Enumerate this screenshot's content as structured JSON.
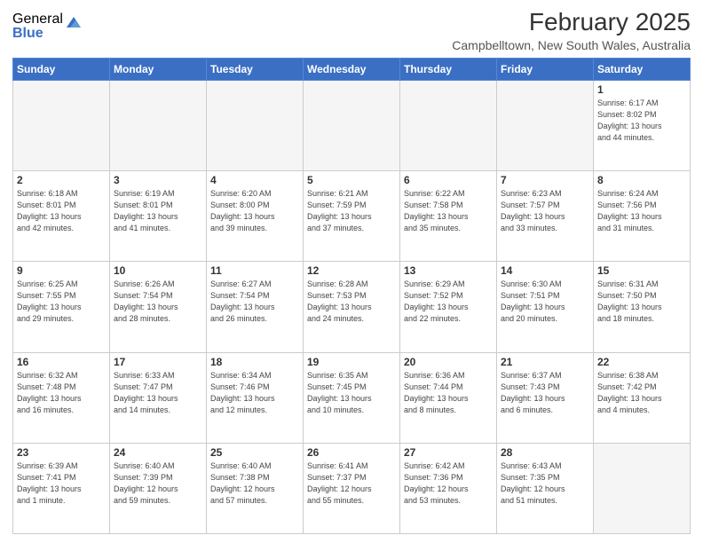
{
  "logo": {
    "general": "General",
    "blue": "Blue"
  },
  "title": "February 2025",
  "location": "Campbelltown, New South Wales, Australia",
  "days_of_week": [
    "Sunday",
    "Monday",
    "Tuesday",
    "Wednesday",
    "Thursday",
    "Friday",
    "Saturday"
  ],
  "weeks": [
    [
      {
        "day": "",
        "info": ""
      },
      {
        "day": "",
        "info": ""
      },
      {
        "day": "",
        "info": ""
      },
      {
        "day": "",
        "info": ""
      },
      {
        "day": "",
        "info": ""
      },
      {
        "day": "",
        "info": ""
      },
      {
        "day": "1",
        "info": "Sunrise: 6:17 AM\nSunset: 8:02 PM\nDaylight: 13 hours\nand 44 minutes."
      }
    ],
    [
      {
        "day": "2",
        "info": "Sunrise: 6:18 AM\nSunset: 8:01 PM\nDaylight: 13 hours\nand 42 minutes."
      },
      {
        "day": "3",
        "info": "Sunrise: 6:19 AM\nSunset: 8:01 PM\nDaylight: 13 hours\nand 41 minutes."
      },
      {
        "day": "4",
        "info": "Sunrise: 6:20 AM\nSunset: 8:00 PM\nDaylight: 13 hours\nand 39 minutes."
      },
      {
        "day": "5",
        "info": "Sunrise: 6:21 AM\nSunset: 7:59 PM\nDaylight: 13 hours\nand 37 minutes."
      },
      {
        "day": "6",
        "info": "Sunrise: 6:22 AM\nSunset: 7:58 PM\nDaylight: 13 hours\nand 35 minutes."
      },
      {
        "day": "7",
        "info": "Sunrise: 6:23 AM\nSunset: 7:57 PM\nDaylight: 13 hours\nand 33 minutes."
      },
      {
        "day": "8",
        "info": "Sunrise: 6:24 AM\nSunset: 7:56 PM\nDaylight: 13 hours\nand 31 minutes."
      }
    ],
    [
      {
        "day": "9",
        "info": "Sunrise: 6:25 AM\nSunset: 7:55 PM\nDaylight: 13 hours\nand 29 minutes."
      },
      {
        "day": "10",
        "info": "Sunrise: 6:26 AM\nSunset: 7:54 PM\nDaylight: 13 hours\nand 28 minutes."
      },
      {
        "day": "11",
        "info": "Sunrise: 6:27 AM\nSunset: 7:54 PM\nDaylight: 13 hours\nand 26 minutes."
      },
      {
        "day": "12",
        "info": "Sunrise: 6:28 AM\nSunset: 7:53 PM\nDaylight: 13 hours\nand 24 minutes."
      },
      {
        "day": "13",
        "info": "Sunrise: 6:29 AM\nSunset: 7:52 PM\nDaylight: 13 hours\nand 22 minutes."
      },
      {
        "day": "14",
        "info": "Sunrise: 6:30 AM\nSunset: 7:51 PM\nDaylight: 13 hours\nand 20 minutes."
      },
      {
        "day": "15",
        "info": "Sunrise: 6:31 AM\nSunset: 7:50 PM\nDaylight: 13 hours\nand 18 minutes."
      }
    ],
    [
      {
        "day": "16",
        "info": "Sunrise: 6:32 AM\nSunset: 7:48 PM\nDaylight: 13 hours\nand 16 minutes."
      },
      {
        "day": "17",
        "info": "Sunrise: 6:33 AM\nSunset: 7:47 PM\nDaylight: 13 hours\nand 14 minutes."
      },
      {
        "day": "18",
        "info": "Sunrise: 6:34 AM\nSunset: 7:46 PM\nDaylight: 13 hours\nand 12 minutes."
      },
      {
        "day": "19",
        "info": "Sunrise: 6:35 AM\nSunset: 7:45 PM\nDaylight: 13 hours\nand 10 minutes."
      },
      {
        "day": "20",
        "info": "Sunrise: 6:36 AM\nSunset: 7:44 PM\nDaylight: 13 hours\nand 8 minutes."
      },
      {
        "day": "21",
        "info": "Sunrise: 6:37 AM\nSunset: 7:43 PM\nDaylight: 13 hours\nand 6 minutes."
      },
      {
        "day": "22",
        "info": "Sunrise: 6:38 AM\nSunset: 7:42 PM\nDaylight: 13 hours\nand 4 minutes."
      }
    ],
    [
      {
        "day": "23",
        "info": "Sunrise: 6:39 AM\nSunset: 7:41 PM\nDaylight: 13 hours\nand 1 minute."
      },
      {
        "day": "24",
        "info": "Sunrise: 6:40 AM\nSunset: 7:39 PM\nDaylight: 12 hours\nand 59 minutes."
      },
      {
        "day": "25",
        "info": "Sunrise: 6:40 AM\nSunset: 7:38 PM\nDaylight: 12 hours\nand 57 minutes."
      },
      {
        "day": "26",
        "info": "Sunrise: 6:41 AM\nSunset: 7:37 PM\nDaylight: 12 hours\nand 55 minutes."
      },
      {
        "day": "27",
        "info": "Sunrise: 6:42 AM\nSunset: 7:36 PM\nDaylight: 12 hours\nand 53 minutes."
      },
      {
        "day": "28",
        "info": "Sunrise: 6:43 AM\nSunset: 7:35 PM\nDaylight: 12 hours\nand 51 minutes."
      },
      {
        "day": "",
        "info": ""
      }
    ]
  ]
}
